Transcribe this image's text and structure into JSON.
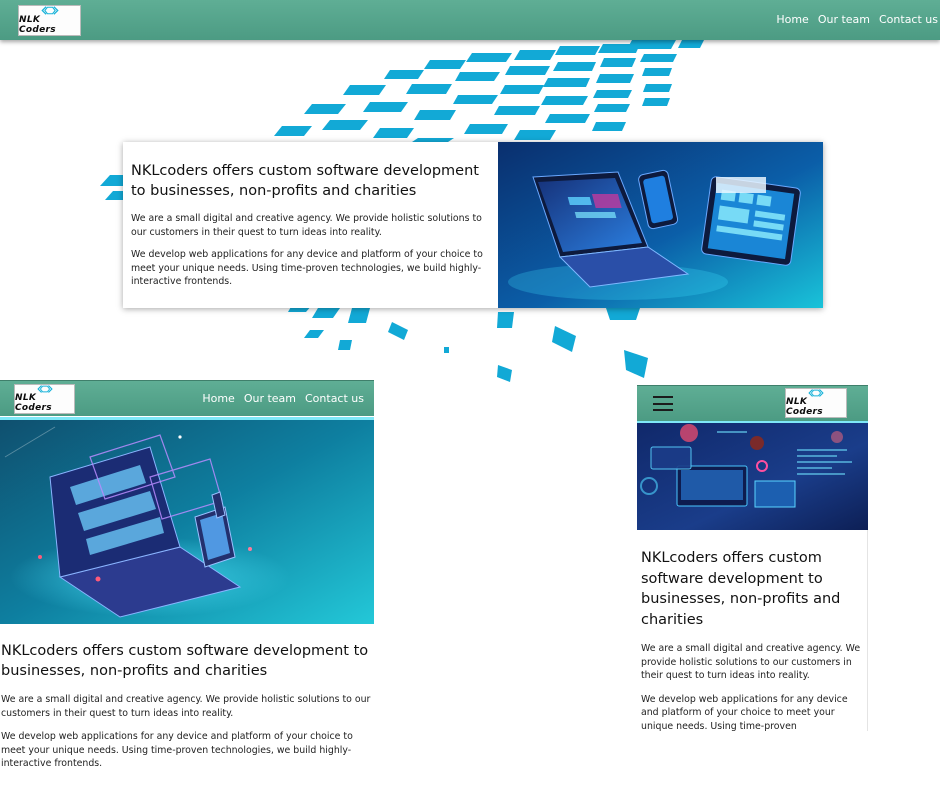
{
  "brand": {
    "logo_text": "NLK Coders",
    "primary_color": "#58a88f",
    "accent_color": "#1ab3d9"
  },
  "nav": {
    "home": "Home",
    "team": "Our team",
    "contact": "Contact us"
  },
  "hero": {
    "heading": "NKLcoders offers custom software development to businesses, non-profits and charities",
    "para1": "We are a small digital and creative agency. We provide holistic solutions to our customers in their quest to turn ideas into reality.",
    "para2": "We develop web applications for any device and platform of your choice to meet your unique needs. Using time-proven technologies, we build highly-interactive frontends."
  },
  "mobile": {
    "heading": "NKLcoders offers custom software development to businesses, non-profits and charities",
    "para1": "We are a small digital and creative agency. We provide holistic solutions to our customers in their quest to turn ideas into reality.",
    "para2": "We develop web applications for any device and platform of your choice to meet your unique needs. Using time-proven"
  },
  "icons": {
    "logo": "code-brackets-icon",
    "menu": "hamburger-menu-icon"
  }
}
